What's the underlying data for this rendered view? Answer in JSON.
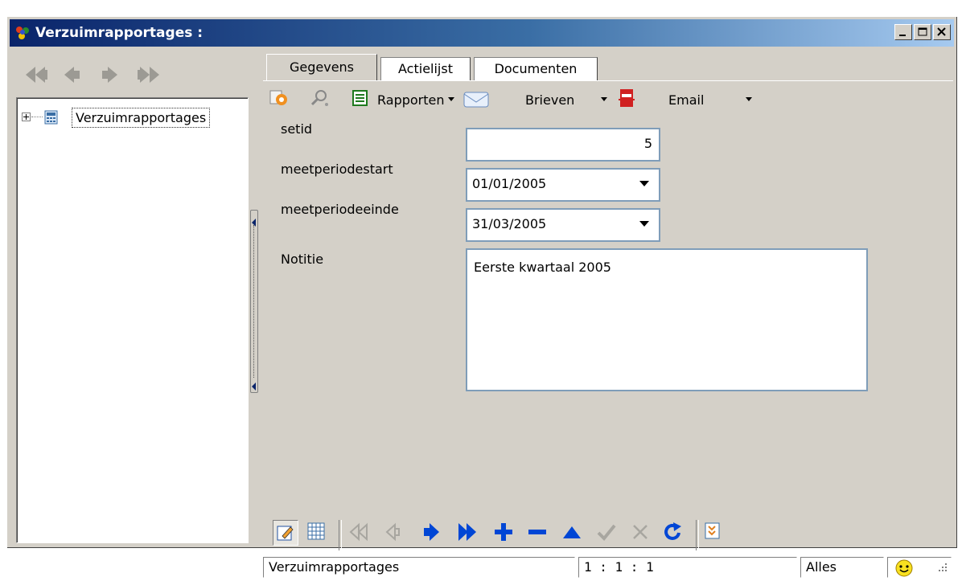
{
  "window": {
    "title": "Verzuimrapportages :",
    "minimize_icon": "minimize-icon",
    "maximize_icon": "maximize-icon",
    "close_icon": "close-icon"
  },
  "nav": {
    "icons": [
      "first-record-icon",
      "previous-record-icon",
      "next-record-icon",
      "last-record-icon"
    ]
  },
  "tree": {
    "root_label": "Verzuimrapportages",
    "root_icon": "calculator-icon"
  },
  "tabs": [
    {
      "label": "Gegevens",
      "active": true
    },
    {
      "label": "Actielijst",
      "active": false
    },
    {
      "label": "Documenten",
      "active": false
    }
  ],
  "toolbar": {
    "rapporten_label": "Rapporten",
    "brieven_label": "Brieven",
    "email_label": "Email"
  },
  "form": {
    "setid_label": "setid",
    "setid_value": "5",
    "start_label": "meetperiodestart",
    "start_value": "01/01/2005",
    "end_label": "meetperiodeeinde",
    "end_value": "31/03/2005",
    "notitie_label": "Notitie",
    "notitie_value": "Eerste kwartaal 2005"
  },
  "status": {
    "table_name": "Verzuimrapportages",
    "record_position": "1 : 1 : 1",
    "filter": "Alles"
  },
  "colors": {
    "title_start": "#0a246a",
    "title_end": "#a6caf0",
    "nav_blue": "#0046d5",
    "face": "#d4d0c8",
    "field_border": "#7f9db9"
  }
}
